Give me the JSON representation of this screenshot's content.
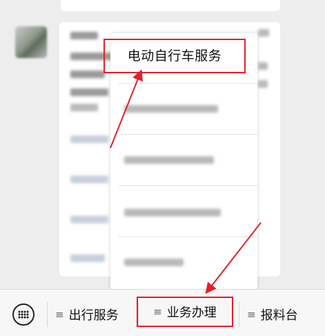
{
  "dropdown": {
    "title": "电动自行车服务",
    "items": [
      {
        "label": "",
        "blurred": true
      },
      {
        "label": "",
        "blurred": true
      },
      {
        "label": "",
        "blurred": true
      },
      {
        "label": "",
        "blurred": true
      }
    ]
  },
  "bottom_menu": {
    "keyboard_icon": "keyboard-icon",
    "menu_icon_glyph": "≡",
    "tabs": [
      {
        "label": "出行服务",
        "icon": "menu-icon"
      },
      {
        "label": "业务办理",
        "icon": "menu-icon",
        "highlighted": true
      },
      {
        "label": "报料台",
        "icon": "menu-icon"
      }
    ]
  },
  "annotation": {
    "color": "#e0202c"
  }
}
